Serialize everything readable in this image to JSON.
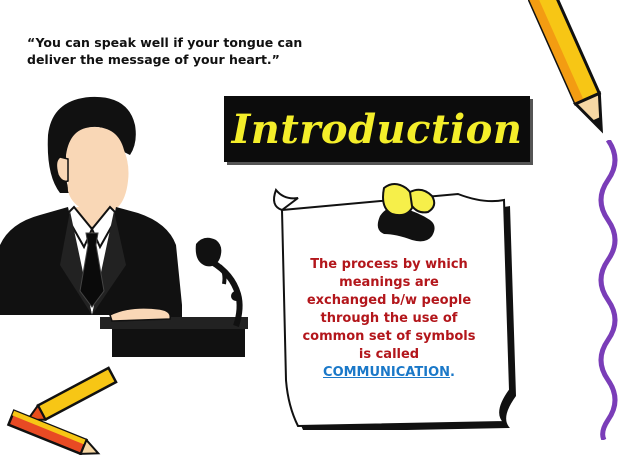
{
  "quote": {
    "line1": "“You can speak well if your tongue can",
    "line2": "deliver the message of your heart.”"
  },
  "title": "Introduction",
  "definition": {
    "lines": [
      "The process by which",
      "meanings are",
      "exchanged b/w people",
      "through the use of",
      "common set of symbols",
      "is called"
    ],
    "term": "COMMUNICATION",
    "term_suffix": "."
  },
  "colors": {
    "title_bg": "#0c0c0c",
    "title_text": "#f4ee2a",
    "definition_text": "#b3161b",
    "term_link": "#1a78c8",
    "border_wave": "#7a3db8"
  },
  "icons": [
    "speaker-figure-icon",
    "microphone-icon",
    "note-paper-icon",
    "paper-clip-icon",
    "pencil-icon",
    "crayon-icon"
  ]
}
